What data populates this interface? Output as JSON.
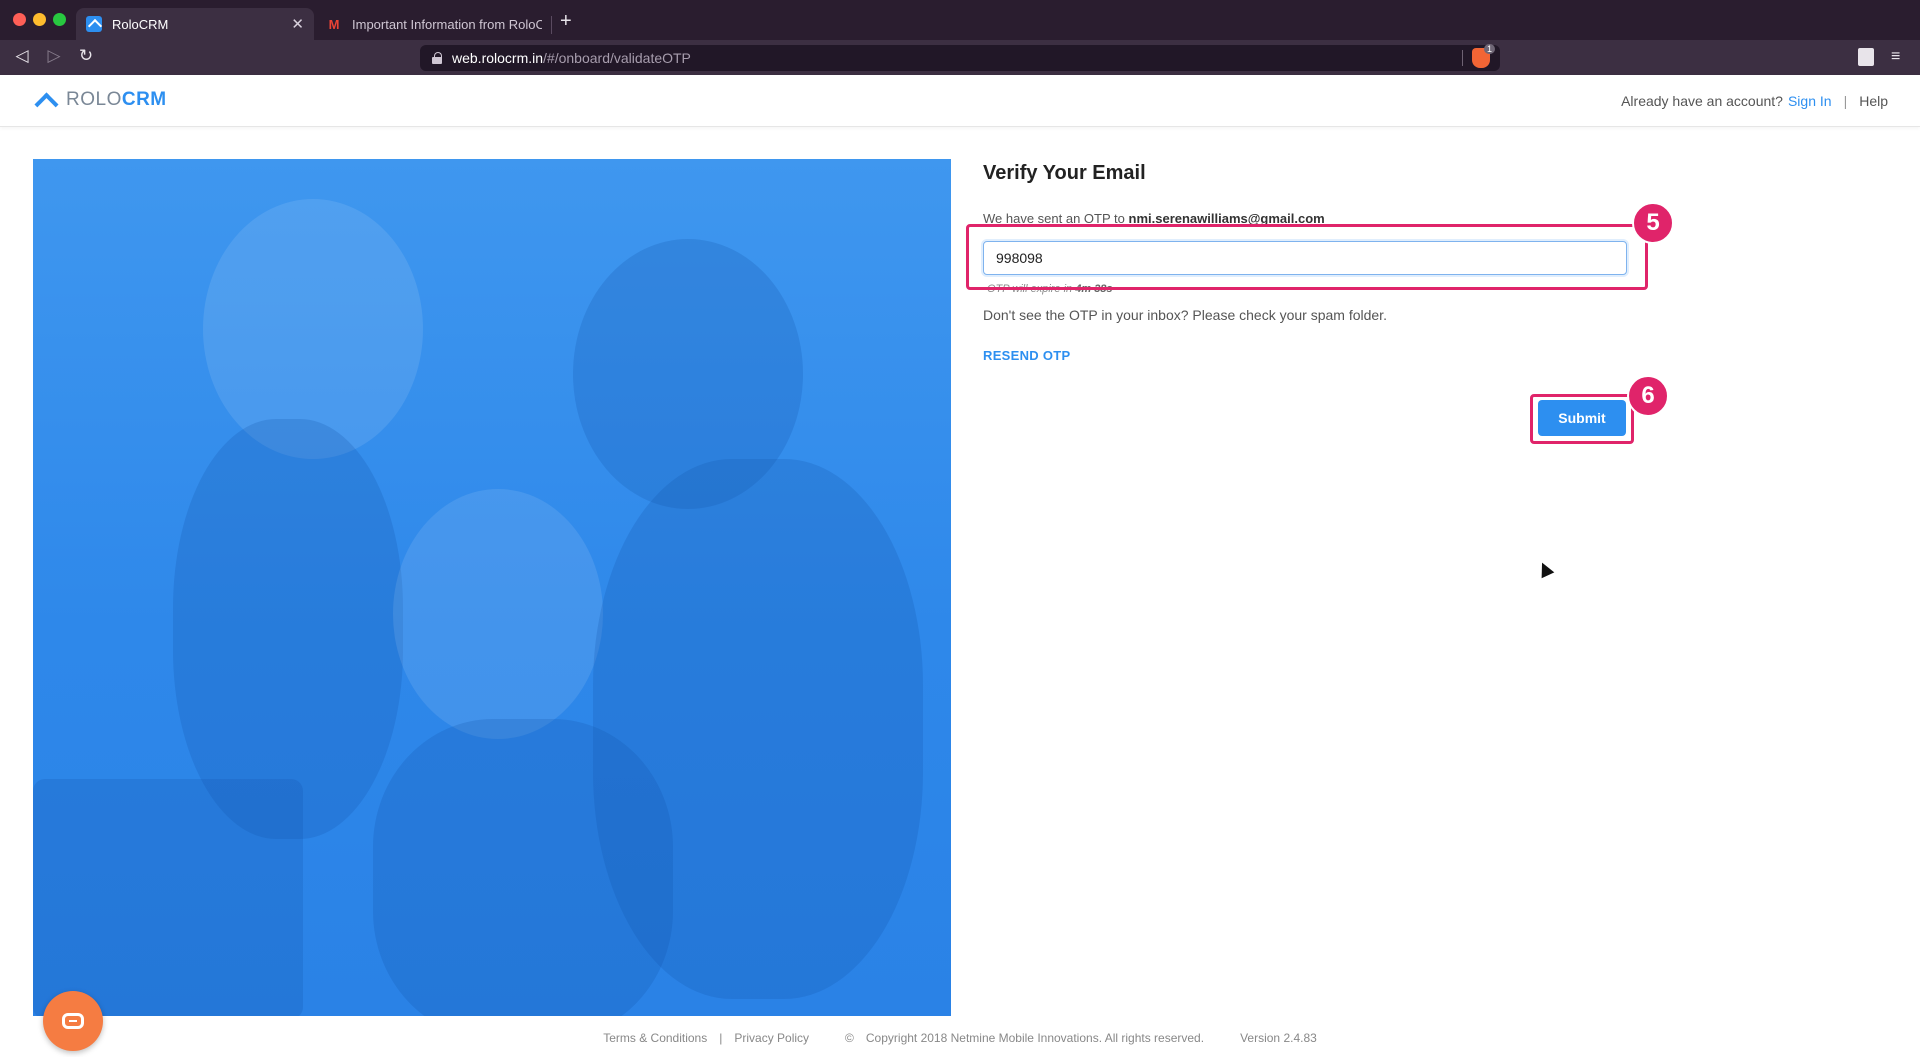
{
  "browser": {
    "tabs": [
      {
        "label": "RoloCRM",
        "active": true,
        "favicon": "rolocrm-logo-icon"
      },
      {
        "label": "Important Information from RoloCRM",
        "active": false,
        "favicon": "gmail-icon"
      }
    ],
    "close_glyph": "✕",
    "new_tab_glyph": "+",
    "url_host": "web.rolocrm.in",
    "url_path": "/#/onboard/validateOTP",
    "brave_badge": "1",
    "back_glyph": "◁",
    "forward_glyph": "▷",
    "reload_glyph": "↻",
    "menu_glyph": "≡"
  },
  "header": {
    "logo_part1": "ROLO",
    "logo_part2": "CRM",
    "already_text": "Already have an account?",
    "signin_label": "Sign In",
    "divider": "|",
    "help_label": "Help"
  },
  "form": {
    "title": "Verify Your Email",
    "sent_prefix": "We have sent an OTP to",
    "email": "nmi.serenawilliams@gmail.com",
    "otp_value": "998098",
    "expire_prefix": "OTP will expire in",
    "expire_time": "4m 38s",
    "spam_text": "Don't see the OTP in your inbox? Please check your spam folder.",
    "resend_label": "RESEND OTP",
    "submit_label": "Submit"
  },
  "annotations": {
    "step_otp": "5",
    "step_submit": "6"
  },
  "footer": {
    "terms": "Terms & Conditions",
    "sep": "|",
    "privacy": "Privacy Policy",
    "copyright_symbol": "©",
    "copyright": "Copyright 2018 Netmine Mobile Innovations. All rights reserved.",
    "version": "Version 2.4.83"
  },
  "colors": {
    "brand_blue": "#2d8ff0",
    "annotation_pink": "#e0246a",
    "chat_orange": "#f57c42"
  }
}
